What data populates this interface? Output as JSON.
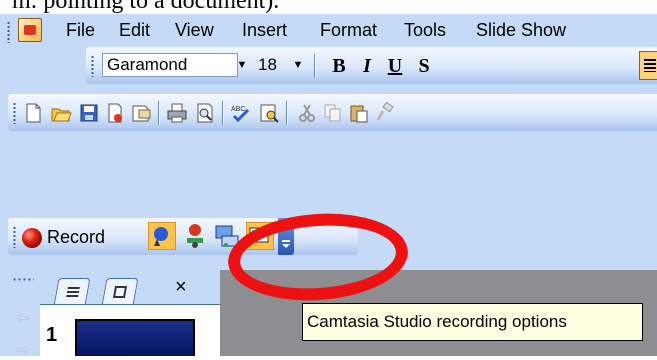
{
  "document_snippet": "m: pointing to a document).",
  "menu": {
    "items": [
      "File",
      "Edit",
      "View",
      "Insert",
      "Format",
      "Tools",
      "Slide Show"
    ]
  },
  "formatting_toolbar": {
    "font_name": "Garamond",
    "font_size": "18",
    "bold": "B",
    "italic": "I",
    "underline": "U",
    "shadow": "S"
  },
  "standard_toolbar": {
    "icons": [
      "new-icon",
      "open-icon",
      "save-icon",
      "permission-icon",
      "email-icon",
      "print-icon",
      "print-preview-icon",
      "spelling-icon",
      "research-icon",
      "cut-icon",
      "copy-icon",
      "paste-icon",
      "format-painter-icon"
    ]
  },
  "camtasia_toolbar": {
    "record_label": "Record"
  },
  "task_pane": {
    "close_label": "×",
    "slide_number": "1"
  },
  "tooltip": {
    "text": "Camtasia Studio recording options"
  },
  "colors": {
    "chrome": "#c4daf7",
    "highlight": "#ee1111",
    "tooltip_bg": "#ffffe1",
    "workspace": "#8d8d92"
  }
}
